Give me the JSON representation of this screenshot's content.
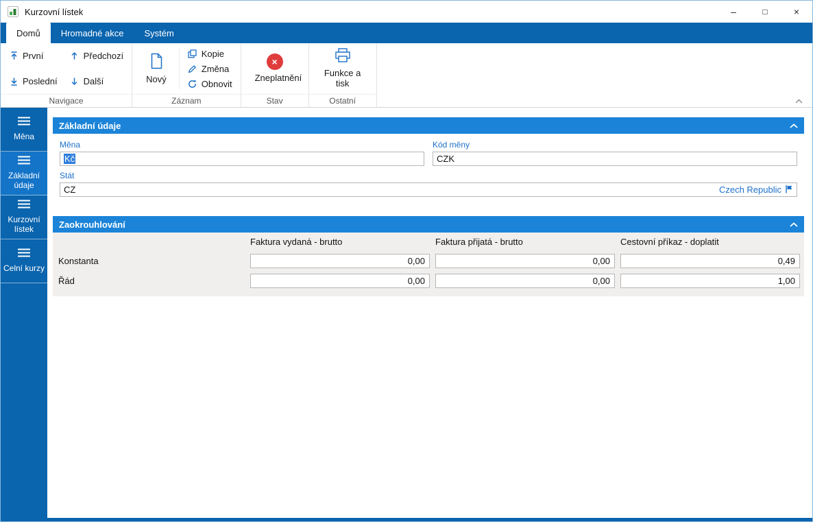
{
  "window": {
    "title": "Kurzovní lístek",
    "controls": {
      "minimize": "–",
      "maximize": "□",
      "close": "×"
    }
  },
  "ribbon": {
    "tabs": [
      {
        "label": "Domů",
        "active": true
      },
      {
        "label": "Hromadné akce",
        "active": false
      },
      {
        "label": "Systém",
        "active": false
      }
    ],
    "navigace": {
      "label": "Navigace",
      "first": "První",
      "previous": "Předchozí",
      "last": "Poslední",
      "next": "Další"
    },
    "zaznam": {
      "label": "Záznam",
      "new": "Nový",
      "copy": "Kopie",
      "change": "Změna",
      "refresh": "Obnovit"
    },
    "stav": {
      "label": "Stav",
      "invalidate": "Zneplatnění"
    },
    "ostatni": {
      "label": "Ostatní",
      "functions_print": "Funkce a tisk"
    }
  },
  "sidebar": {
    "items": [
      {
        "label": "Měna",
        "active": false
      },
      {
        "label": "Základní údaje",
        "active": true
      },
      {
        "label": "Kurzovní lístek",
        "active": false
      },
      {
        "label": "Celní kurzy",
        "active": false
      }
    ]
  },
  "basic": {
    "title": "Základní údaje",
    "mena_label": "Měna",
    "mena_value": "Kč",
    "kod_label": "Kód měny",
    "kod_value": "CZK",
    "stat_label": "Stát",
    "stat_value": "CZ",
    "stat_country": "Czech Republic"
  },
  "rounding": {
    "title": "Zaokrouhlování",
    "columns": [
      "Faktura vydaná - brutto",
      "Faktura přijatá - brutto",
      "Cestovní příkaz - doplatit"
    ],
    "rows": [
      {
        "label": "Konstanta",
        "values": [
          "0,00",
          "0,00",
          "0,49"
        ]
      },
      {
        "label": "Řád",
        "values": [
          "0,00",
          "0,00",
          "1,00"
        ]
      }
    ]
  },
  "colors": {
    "primary_blue": "#0a64ae",
    "sidebar_active_blue": "#1474c8",
    "section_header_blue": "#1b84d9",
    "label_blue": "#1c70c8",
    "invalid_red": "#e03c3c",
    "selection_blue": "#2e7ddb",
    "table_gray": "#f1efed"
  }
}
